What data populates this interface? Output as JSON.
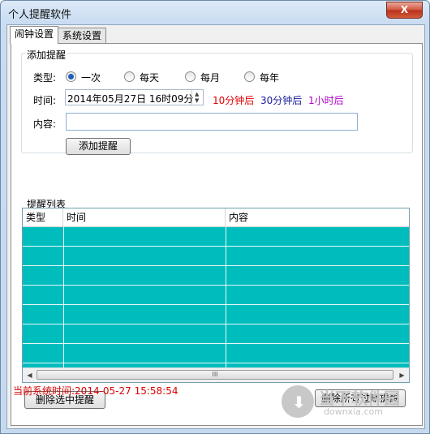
{
  "window": {
    "title": "个人提醒软件",
    "close_glyph": "X"
  },
  "tabs": [
    {
      "label": "闹钟设置",
      "active": true
    },
    {
      "label": "系统设置",
      "active": false
    }
  ],
  "add_group": {
    "title": "添加提醒",
    "type_label": "类型:",
    "types": [
      {
        "label": "一次",
        "checked": true
      },
      {
        "label": "每天",
        "checked": false
      },
      {
        "label": "每月",
        "checked": false
      },
      {
        "label": "每年",
        "checked": false
      }
    ],
    "time_label": "时间:",
    "time_value": "2014年05月27日 16时09分",
    "quick_links": [
      {
        "label": "10分钟后",
        "color": "#e00000"
      },
      {
        "label": "30分钟后",
        "color": "#1a1a9c"
      },
      {
        "label": "1小时后",
        "color": "#b000c8"
      }
    ],
    "content_label": "内容:",
    "content_value": "",
    "add_button": "添加提醒"
  },
  "list_group": {
    "title": "提醒列表",
    "columns": [
      "类型",
      "时间",
      "内容"
    ],
    "row_count": 7,
    "row_color": "#00bdbd",
    "scroll_thumb_grip": "III"
  },
  "buttons": {
    "delete_selected": "删除选中提醒",
    "delete_expired": "删除所有过期提醒"
  },
  "status": {
    "text": "当前系统时间:2014-05-27 15:58:54",
    "color": "#d90000"
  },
  "watermark": {
    "name": "当下软件园",
    "domain": "downxia.com"
  }
}
